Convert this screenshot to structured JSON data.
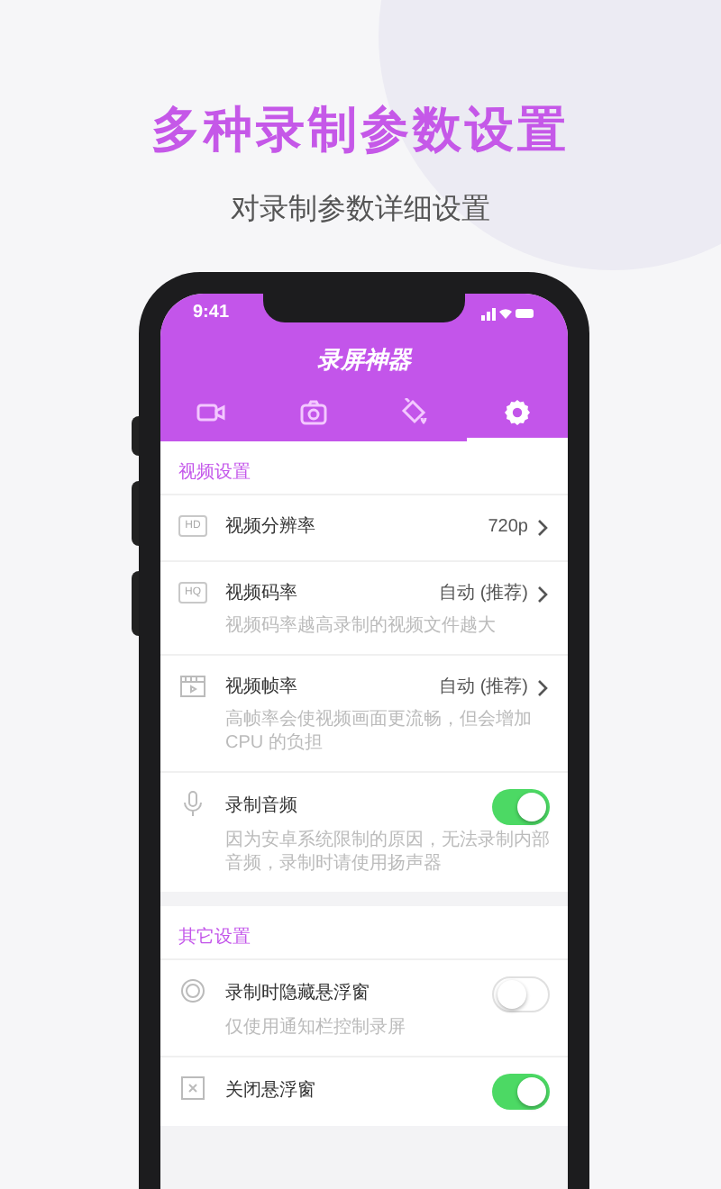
{
  "headline": "多种录制参数设置",
  "subheadline": "对录制参数详细设置",
  "status_bar": {
    "time": "9:41"
  },
  "app_title": "录屏神器",
  "tabs": [
    {
      "kind": "video",
      "selected": false
    },
    {
      "kind": "camera",
      "selected": false
    },
    {
      "kind": "paint",
      "selected": false
    },
    {
      "kind": "settings",
      "selected": true
    }
  ],
  "sections": [
    {
      "title": "视频设置",
      "items": [
        {
          "kind": "link",
          "badge": "HD",
          "label": "视频分辨率",
          "value": "720p"
        },
        {
          "kind": "link",
          "badge": "HQ",
          "label": "视频码率",
          "value": "自动 (推荐)",
          "description": "视频码率越高录制的视频文件越大"
        },
        {
          "kind": "link",
          "label": "视频帧率",
          "value": "自动 (推荐)",
          "description": "高帧率会使视频画面更流畅，但会增加 CPU 的负担"
        },
        {
          "kind": "toggle",
          "label": "录制音频",
          "on": true,
          "description": "因为安卓系统限制的原因，无法录制内部音频，录制时请使用扬声器"
        }
      ]
    },
    {
      "title": "其它设置",
      "items": [
        {
          "kind": "toggle",
          "label": "录制时隐藏悬浮窗",
          "on": false,
          "description": "仅使用通知栏控制录屏"
        },
        {
          "kind": "toggle",
          "label": "关闭悬浮窗",
          "on": true
        }
      ]
    }
  ]
}
